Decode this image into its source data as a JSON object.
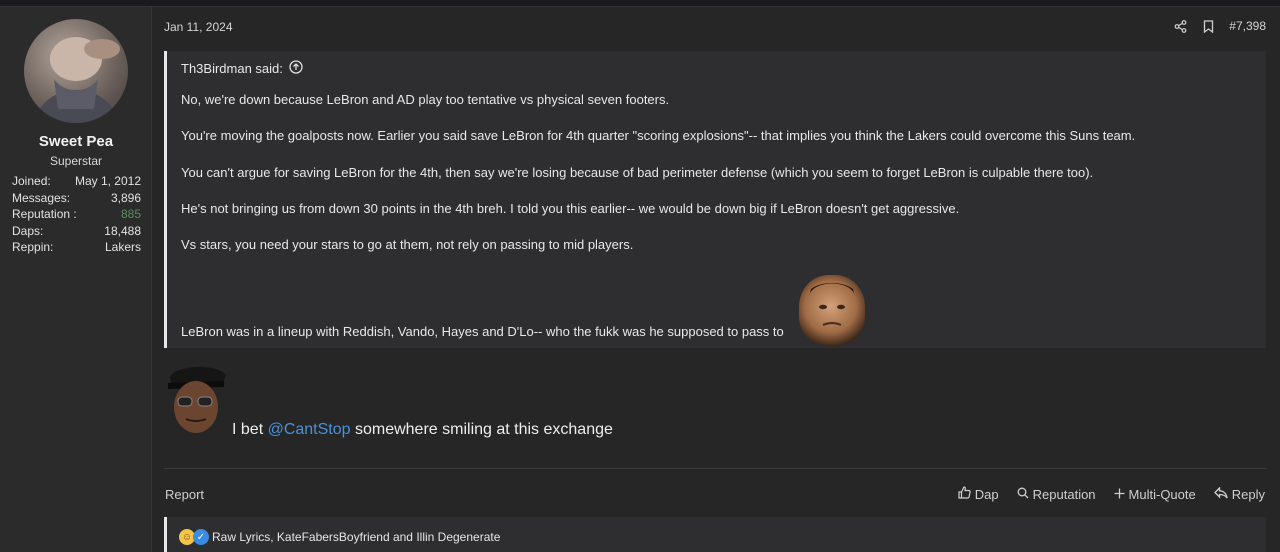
{
  "user": {
    "name": "Sweet Pea",
    "title": "Superstar",
    "stats": [
      {
        "label": "Joined:",
        "value": "May 1, 2012"
      },
      {
        "label": "Messages:",
        "value": "3,896"
      },
      {
        "label": "Reputation :",
        "value": "885"
      },
      {
        "label": "Daps:",
        "value": "18,488"
      },
      {
        "label": "Reppin:",
        "value": "Lakers"
      }
    ]
  },
  "post": {
    "date": "Jan 11, 2024",
    "number": "#7,398",
    "quote": {
      "author_line": "Th3Birdman said:",
      "paragraphs": [
        "No, we're down because LeBron and AD play too tentative vs physical seven footers.",
        "You're moving the goalposts now. Earlier you said save LeBron for 4th quarter \"scoring explosions\"-- that implies you think the Lakers could overcome this Suns team.",
        "You can't argue for saving LeBron for the 4th, then say we're losing because of bad perimeter defense (which you seem to forget LeBron is culpable there too).",
        "He's not bringing us from down 30 points in the 4th breh. I told you this earlier-- we would be down big if LeBron doesn't get aggressive.",
        "Vs stars, you need your stars to go at them, not rely on passing to mid players."
      ],
      "last_line": "LeBron was in a lineup with Reddish, Vando, Hayes and D'Lo-- who the fukk was he supposed to pass to"
    },
    "reply": {
      "before": "I bet ",
      "mention": "@CantStop",
      "after": " somewhere smiling at this exchange"
    },
    "footer": {
      "report": "Report",
      "dap": "Dap",
      "reputation": "Reputation",
      "multiquote": "Multi-Quote",
      "reply": "Reply"
    },
    "reactions_text": "Raw Lyrics, KateFabersBoyfriend and Illin Degenerate"
  }
}
